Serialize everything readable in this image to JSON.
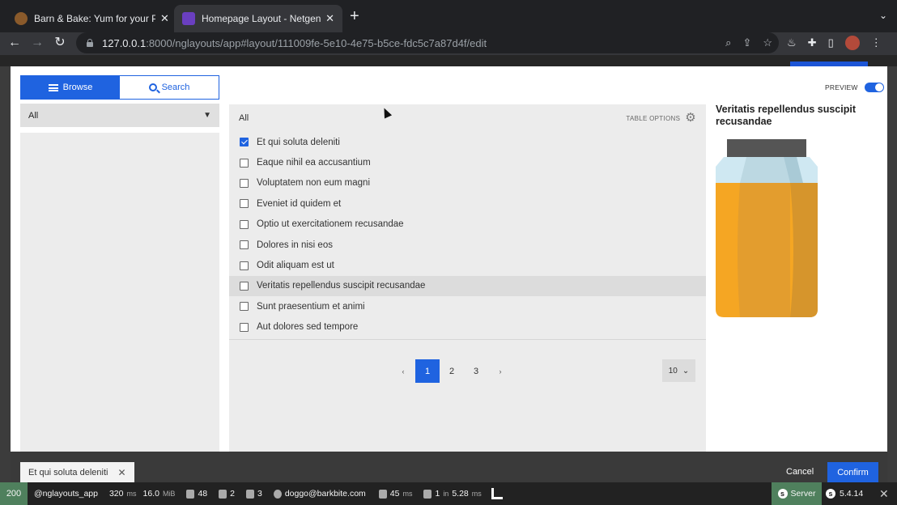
{
  "browser": {
    "tabs": [
      {
        "title": "Barn & Bake: Yum for your Pup",
        "close": "✕",
        "favicon_color": "#8a5a2b"
      },
      {
        "title": "Homepage Layout - Netgen La",
        "close": "✕",
        "favicon_color": "#6a3fc0"
      }
    ],
    "new_tab": "+",
    "tab_menu": "⌄",
    "url_host": "127.0.0.1",
    "url_rest": ":8000/nglayouts/app#layout/111009fe-5e10-4e75-b5ce-fdc5c7a87d4f/edit"
  },
  "modal": {
    "browse_label": "Browse",
    "search_label": "Search",
    "location_select": "All",
    "list_header": "All",
    "table_options": "TABLE OPTIONS",
    "preview_label": "PREVIEW",
    "preview_enabled": true,
    "items": [
      {
        "label": "Et qui soluta deleniti",
        "checked": true
      },
      {
        "label": "Eaque nihil ea accusantium",
        "checked": false
      },
      {
        "label": "Voluptatem non eum magni",
        "checked": false
      },
      {
        "label": "Eveniet id quidem et",
        "checked": false
      },
      {
        "label": "Optio ut exercitationem recusandae",
        "checked": false
      },
      {
        "label": "Dolores in nisi eos",
        "checked": false
      },
      {
        "label": "Odit aliquam est ut",
        "checked": false
      },
      {
        "label": "Veritatis repellendus suscipit recusandae",
        "checked": false
      },
      {
        "label": "Sunt praesentium et animi",
        "checked": false
      },
      {
        "label": "Aut dolores sed tempore",
        "checked": false
      }
    ],
    "pagination": {
      "prev": "‹",
      "pages": [
        "1",
        "2",
        "3"
      ],
      "current": "1",
      "next": "›"
    },
    "per_page": "10",
    "preview_title": "Veritatis repellendus suscipit recusandae",
    "selected_chip": "Et qui soluta deleniti",
    "cancel_label": "Cancel",
    "confirm_label": "Confirm"
  },
  "symfony_toolbar": {
    "status": "200",
    "route": "@nglayouts_app",
    "time": "320",
    "time_unit": "ms",
    "memory": "16.0",
    "memory_unit": "MiB",
    "forms": "48",
    "cache": "2",
    "translations": "3",
    "user": "doggo@barkbite.com",
    "twig_time": "45",
    "twig_unit": "ms",
    "db": "1",
    "db_in": "in",
    "db_time": "5.28",
    "db_unit": "ms",
    "server": "Server",
    "version": "5.4.14"
  },
  "colors": {
    "accent": "#1f63e0",
    "status_ok": "#4f805d",
    "jar_honey": "#f5a623"
  }
}
